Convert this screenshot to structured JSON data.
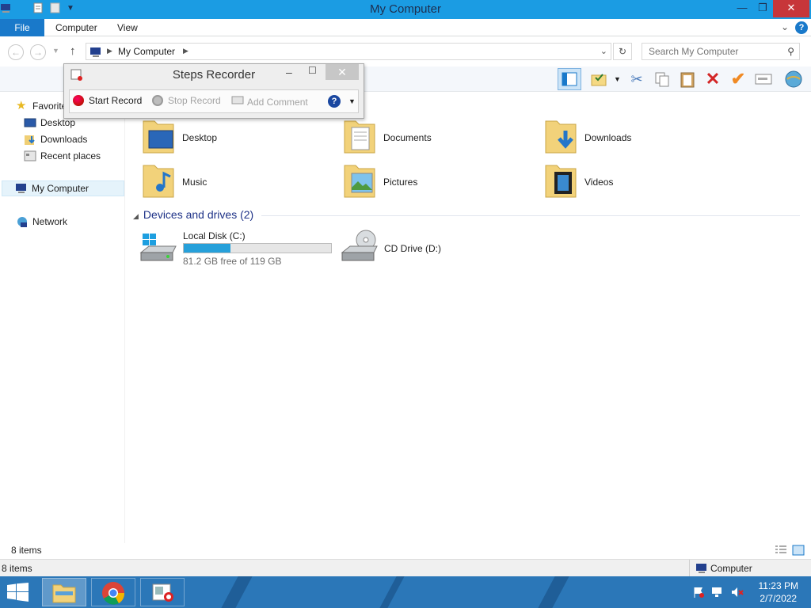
{
  "window": {
    "title": "My Computer"
  },
  "ribbon": {
    "tabs": [
      "File",
      "Computer",
      "View"
    ]
  },
  "address": {
    "crumb": "My Computer",
    "search_placeholder": "Search My Computer"
  },
  "steps_recorder": {
    "title": "Steps Recorder",
    "start_label": "Start Record",
    "stop_label": "Stop Record",
    "comment_label": "Add Comment"
  },
  "nav": {
    "favorites": "Favorites",
    "favorites_items": [
      "Desktop",
      "Downloads",
      "Recent places"
    ],
    "this_pc": "My Computer",
    "network": "Network"
  },
  "folders": [
    "Desktop",
    "Documents",
    "Downloads",
    "Music",
    "Pictures",
    "Videos"
  ],
  "devices": {
    "heading": "Devices and drives (2)",
    "local_disk": {
      "name": "Local Disk (C:)",
      "free_text": "81.2 GB free of 119 GB",
      "used_fraction": 0.318
    },
    "cd_drive": {
      "name": "CD Drive (D:)"
    }
  },
  "status": {
    "items_top": "8 items",
    "items_bottom": "8 items",
    "location": "Computer"
  },
  "clock": {
    "time": "11:23 PM",
    "date": "2/7/2022"
  },
  "colors": {
    "accent": "#1979ca",
    "titlebar": "#1b9ce3",
    "taskbar": "#2b77b8",
    "drive_fill": "#26a0da"
  }
}
